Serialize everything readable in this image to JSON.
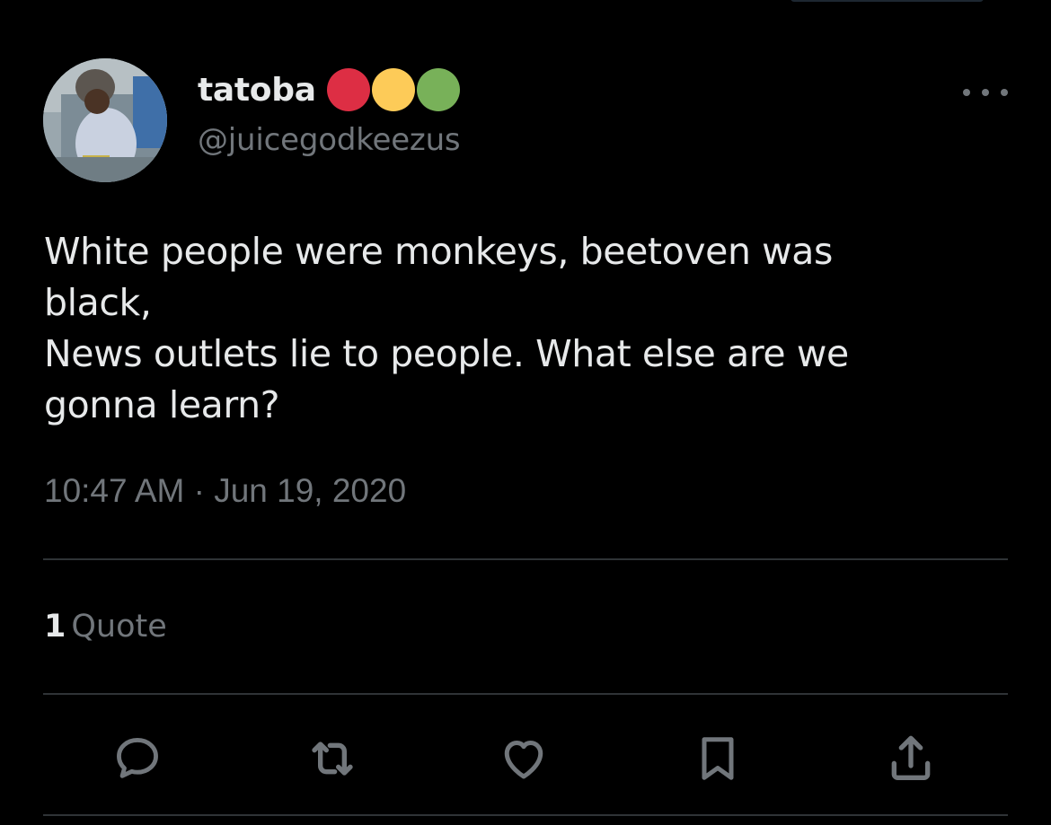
{
  "author": {
    "display_name": "tatoba",
    "handle": "@juicegodkeezus",
    "name_emojis": [
      {
        "icon": "red-circle",
        "color": "#dd2e44"
      },
      {
        "icon": "yellow-circle",
        "color": "#fdcb58"
      },
      {
        "icon": "green-circle",
        "color": "#78b159"
      }
    ]
  },
  "tweet": {
    "lines": [
      "White people were monkeys, beetoven was",
      "black,",
      "News outlets lie to people. What else are we",
      "gonna learn?"
    ],
    "timestamp": "10:47 AM · Jun 19, 2020"
  },
  "stats": {
    "quote_count": "1",
    "quote_label": "Quote"
  },
  "actions": [
    {
      "icon": "reply-icon"
    },
    {
      "icon": "retweet-icon"
    },
    {
      "icon": "like-icon"
    },
    {
      "icon": "bookmark-icon"
    },
    {
      "icon": "share-icon"
    }
  ],
  "colors": {
    "background": "#000000",
    "primary_text": "#e7e9ea",
    "secondary_text": "#71767b",
    "divider": "#2f3336"
  }
}
